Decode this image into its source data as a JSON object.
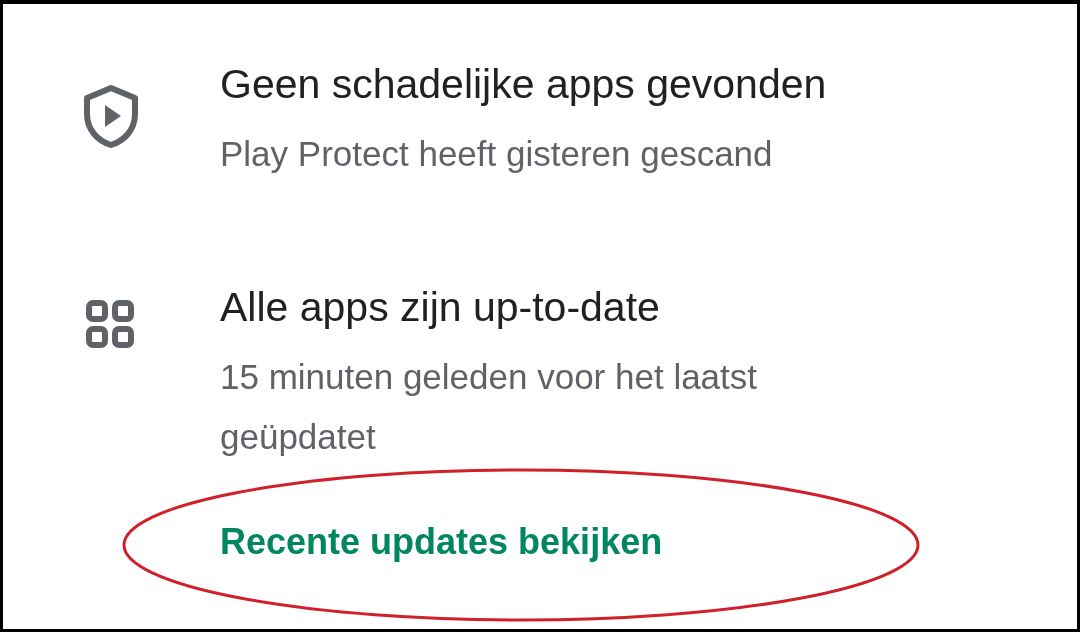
{
  "items": [
    {
      "kind": "shield",
      "title": "Geen schadelijke apps gevonden",
      "subtitle": "Play Protect heeft gisteren gescand"
    },
    {
      "kind": "grid",
      "title": "Alle apps zijn up-to-date",
      "subtitle": "15 minuten geleden voor het laatst geüpdatet",
      "link": "Recente updates bekijken"
    }
  ]
}
